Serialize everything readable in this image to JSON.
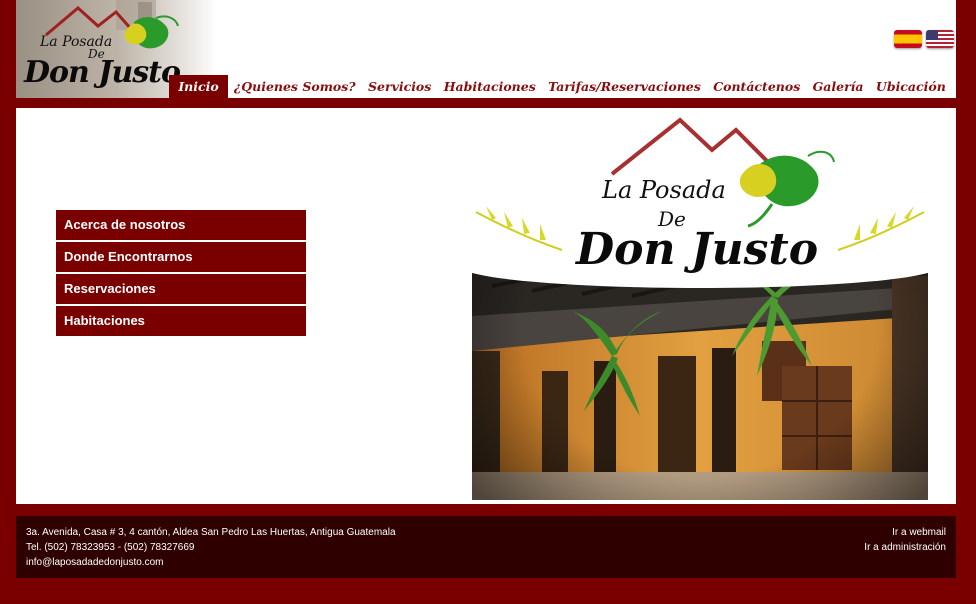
{
  "logo": {
    "line1": "La Posada",
    "line2": "De",
    "line3": "Don Justo"
  },
  "flags": [
    {
      "name": "spanish-flag-icon",
      "label": "Español"
    },
    {
      "name": "us-flag-icon",
      "label": "English"
    }
  ],
  "nav": {
    "items": [
      {
        "label": "Inicio",
        "active": true
      },
      {
        "label": "¿Quienes Somos?"
      },
      {
        "label": "Servicios"
      },
      {
        "label": "Habitaciones"
      },
      {
        "label": "Tarifas/Reservaciones"
      },
      {
        "label": "Contáctenos"
      },
      {
        "label": "Galería"
      },
      {
        "label": "Ubicación"
      }
    ]
  },
  "sidebar": {
    "items": [
      {
        "label": "Acerca de nosotros"
      },
      {
        "label": "Donde Encontrarnos"
      },
      {
        "label": "Reservaciones"
      },
      {
        "label": "Habitaciones"
      }
    ]
  },
  "hero": {
    "line1": "La Posada",
    "line2": "De",
    "line3": "Don Justo"
  },
  "footer": {
    "address": "3a. Avenida, Casa # 3, 4 cantón, Aldea San Pedro Las Huertas, Antigua Guatemala",
    "phone": "Tel. (502) 78323953 - (502) 78327669",
    "email": "info@laposadadedonjusto.com",
    "webmail": "Ir a webmail",
    "admin": "Ir a administración"
  },
  "colors": {
    "brand": "#7a0000",
    "footer_bg": "#2e0000",
    "nav_text": "#8a0d0d"
  }
}
